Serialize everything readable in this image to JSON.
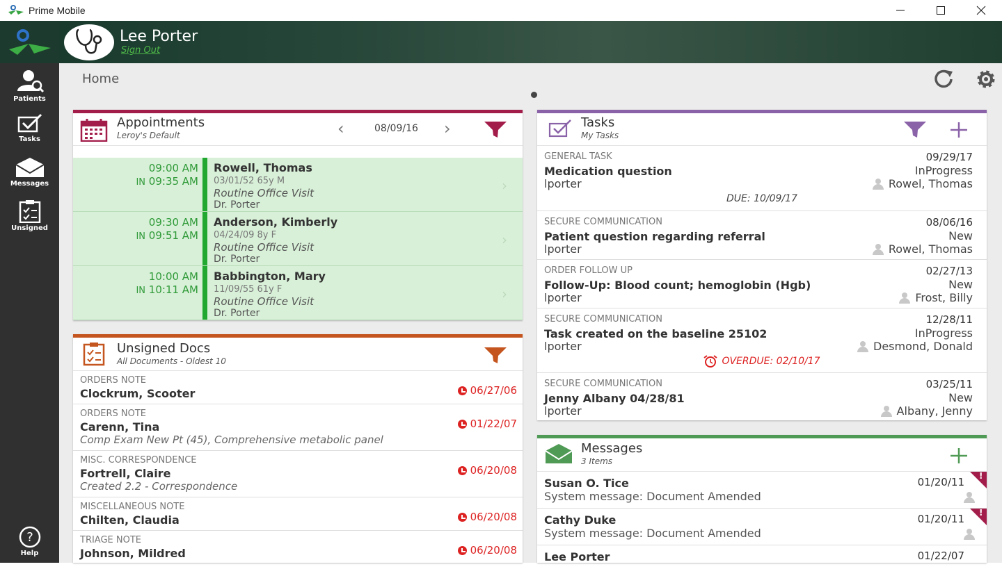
{
  "window": {
    "title": "Prime Mobile"
  },
  "user": {
    "name": "Lee Porter",
    "sign_out": "Sign Out"
  },
  "nav": [
    {
      "label": "Patients",
      "icon": "patient-search-icon"
    },
    {
      "label": "Tasks",
      "icon": "tasks-icon"
    },
    {
      "label": "Messages",
      "icon": "envelope-icon"
    },
    {
      "label": "Unsigned",
      "icon": "clipboard-icon"
    },
    {
      "label": "Help",
      "icon": "help-icon"
    }
  ],
  "breadcrumb": "Home",
  "colors": {
    "appointments": "#a31d4a",
    "unsigned": "#c4551e",
    "tasks": "#8a62a8",
    "messages": "#4f9a54",
    "green": "#2f9a38",
    "red": "#d22222"
  },
  "appointments": {
    "title": "Appointments",
    "subtitle": "Leroy's Default",
    "date": "08/09/16",
    "rows": [
      {
        "time": "09:00 AM",
        "in_label": "IN",
        "in_time": "09:35 AM",
        "name": "Rowell, Thomas",
        "dob": "03/01/52 65y M",
        "visit": "Routine Office Visit",
        "doctor": "Dr. Porter"
      },
      {
        "time": "09:30 AM",
        "in_label": "IN",
        "in_time": "09:51 AM",
        "name": "Anderson, Kimberly",
        "dob": "04/24/09 8y F",
        "visit": "Routine Office Visit",
        "doctor": "Dr. Porter"
      },
      {
        "time": "10:00 AM",
        "in_label": "IN",
        "in_time": "10:11 AM",
        "name": "Babbington, Mary",
        "dob": "11/09/55 61y F",
        "visit": "Routine Office Visit",
        "doctor": "Dr. Porter"
      }
    ]
  },
  "unsigned": {
    "title": "Unsigned Docs",
    "subtitle": "All Documents - Oldest 10",
    "rows": [
      {
        "type": "ORDERS NOTE",
        "name": "Clockrum, Scooter",
        "desc": "",
        "date": "06/27/06"
      },
      {
        "type": "ORDERS NOTE",
        "name": "Carenn, Tina",
        "desc": "Comp Exam New Pt (45), Comprehensive metabolic panel",
        "date": "01/22/07"
      },
      {
        "type": "MISC. CORRESPONDENCE",
        "name": "Fortrell, Claire",
        "desc": "Created 2.2 - Correspondence",
        "date": "06/20/08"
      },
      {
        "type": "MISCELLANEOUS NOTE",
        "name": "Chilten, Claudia",
        "desc": "",
        "date": "06/20/08"
      },
      {
        "type": "TRIAGE NOTE",
        "name": "Johnson, Mildred",
        "desc": "",
        "date": "06/20/08"
      }
    ]
  },
  "tasks": {
    "title": "Tasks",
    "subtitle": "My Tasks",
    "rows": [
      {
        "type": "GENERAL TASK",
        "name": "Medication question",
        "owner": "lporter",
        "date": "09/29/17",
        "status": "InProgress",
        "patient": "Rowel, Thomas",
        "due": "DUE: 10/09/17",
        "overdue": ""
      },
      {
        "type": "SECURE COMMUNICATION",
        "name": "Patient question regarding referral",
        "owner": "lporter",
        "date": "08/06/16",
        "status": "New",
        "patient": "Rowel, Thomas",
        "due": "",
        "overdue": ""
      },
      {
        "type": "ORDER FOLLOW UP",
        "name": "Follow-Up: Blood count; hemoglobin (Hgb)",
        "owner": "lporter",
        "date": "02/27/13",
        "status": "New",
        "patient": "Frost, Billy",
        "due": "",
        "overdue": ""
      },
      {
        "type": "SECURE COMMUNICATION",
        "name": "Task created on the baseline 25102",
        "owner": "lporter",
        "date": "12/28/11",
        "status": "InProgress",
        "patient": "Desmond, Donald",
        "due": "",
        "overdue": "OVERDUE: 02/10/17"
      },
      {
        "type": "SECURE COMMUNICATION",
        "name": "Jenny Albany 04/28/81",
        "owner": "lporter",
        "date": "03/25/11",
        "status": "New",
        "patient": "Albany, Jenny",
        "due": "",
        "overdue": ""
      }
    ]
  },
  "messages": {
    "title": "Messages",
    "subtitle": "3 Items",
    "rows": [
      {
        "from": "Susan O. Tice",
        "text": "System message: Document Amended",
        "date": "01/20/11",
        "flag": "!"
      },
      {
        "from": "Cathy Duke",
        "text": "System message: Document Amended",
        "date": "01/20/11",
        "flag": "!"
      },
      {
        "from": "Lee Porter",
        "text": "",
        "date": "01/22/07",
        "flag": ""
      }
    ]
  }
}
